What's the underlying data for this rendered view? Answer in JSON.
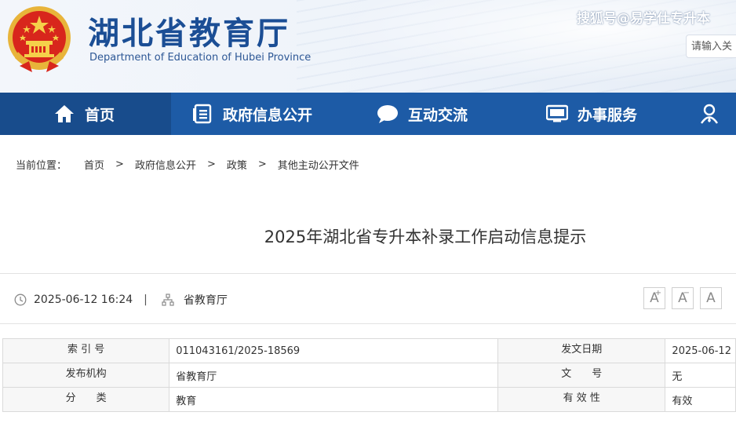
{
  "header": {
    "title": "湖北省教育厅",
    "subtitle": "Department of Education of Hubei Province",
    "watermark": "搜狐号@易学仕专升本",
    "search_placeholder": "请输入关"
  },
  "nav": {
    "items": [
      {
        "label": "首页",
        "icon": "home-icon"
      },
      {
        "label": "政府信息公开",
        "icon": "document-list-icon"
      },
      {
        "label": "互动交流",
        "icon": "chat-bubble-icon"
      },
      {
        "label": "办事服务",
        "icon": "monitor-icon"
      }
    ]
  },
  "breadcrumb": {
    "label": "当前位置：",
    "items": [
      "首页",
      "政府信息公开",
      "政策",
      "其他主动公开文件"
    ],
    "separator": ">"
  },
  "article": {
    "title": "2025年湖北省专升本补录工作启动信息提示",
    "datetime": "2025-06-12 16:24",
    "divider": "|",
    "publisher": "省教育厅"
  },
  "font_controls": [
    "A",
    "A",
    "A"
  ],
  "info_table": {
    "rows": [
      {
        "k1": "索 引 号",
        "v1": "011043161/2025-18569",
        "k2": "发文日期",
        "v2": "2025-06-12"
      },
      {
        "k1": "发布机构",
        "v1": "省教育厅",
        "k2": "文　　号",
        "v2": "无"
      },
      {
        "k1": "分　　类",
        "v1": "教育",
        "k2": "有 效 性",
        "v2": "有效"
      }
    ]
  },
  "colors": {
    "nav_bg": "#1d5ba6",
    "nav_active": "#184c8c",
    "title_blue": "#1b4e95"
  }
}
